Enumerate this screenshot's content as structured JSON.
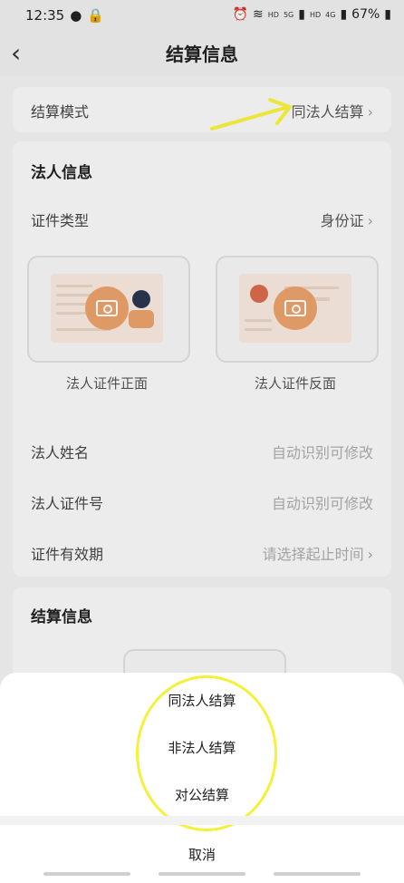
{
  "status": {
    "time": "12:35",
    "battery": "67%",
    "hd1": "HD",
    "hd2": "HD",
    "g5": "5G",
    "g4": "4G"
  },
  "header": {
    "title": "结算信息"
  },
  "settlement": {
    "mode_label": "结算模式",
    "mode_value": "同法人结算"
  },
  "legal": {
    "section_title": "法人信息",
    "id_type_label": "证件类型",
    "id_type_value": "身份证",
    "front_label": "法人证件正面",
    "back_label": "法人证件反面",
    "name_label": "法人姓名",
    "name_hint": "自动识别可修改",
    "id_no_label": "法人证件号",
    "id_no_hint": "自动识别可修改",
    "validity_label": "证件有效期",
    "validity_hint": "请选择起止时间"
  },
  "settlement_info": {
    "section_title": "结算信息"
  },
  "sheet": {
    "options": [
      "同法人结算",
      "非法人结算",
      "对公结算"
    ],
    "cancel": "取消"
  },
  "colors": {
    "accent": "#e9a06a",
    "highlight": "#f5f03a"
  },
  "icons": {
    "back": "chevron-left-icon",
    "camera": "camera-icon",
    "chevron": "chevron-right-icon"
  }
}
